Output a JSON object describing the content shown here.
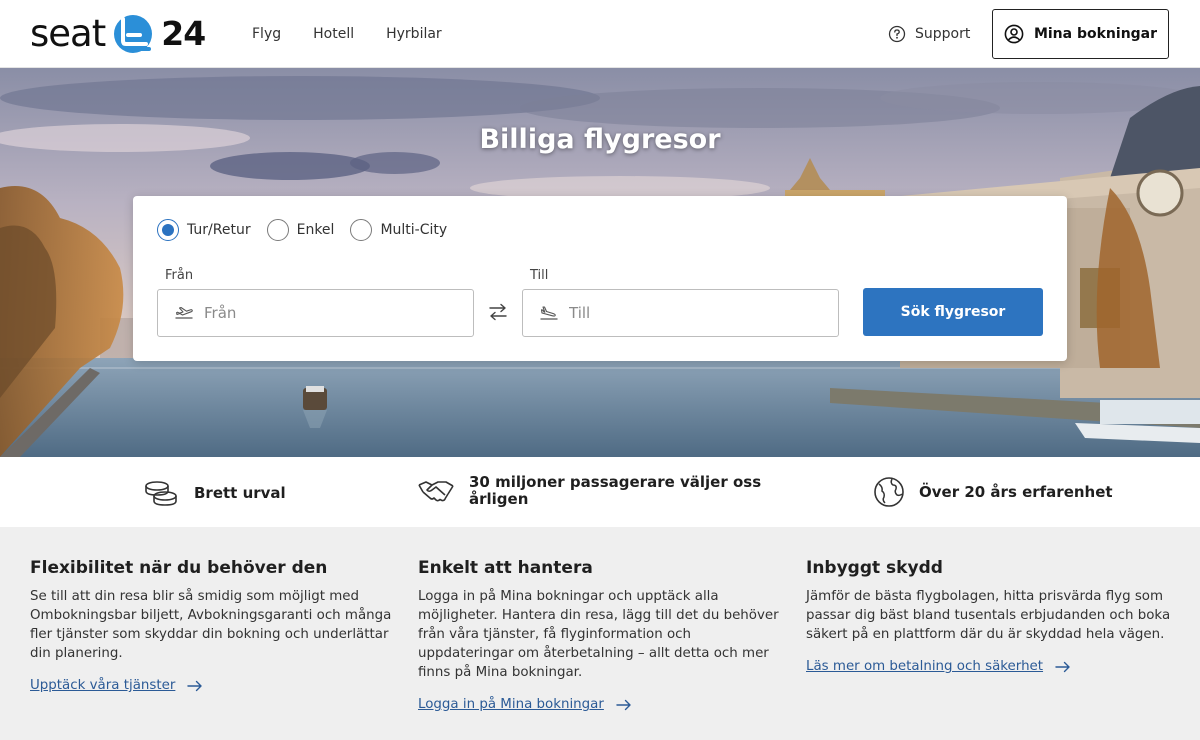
{
  "header": {
    "logo": {
      "word": "seat",
      "number": "24"
    },
    "nav": [
      "Flyg",
      "Hotell",
      "Hyrbilar"
    ],
    "support_label": "Support",
    "my_bookings_label": "Mina bokningar"
  },
  "hero": {
    "title": "Billiga flygresor"
  },
  "search": {
    "trip_types": [
      {
        "label": "Tur/Retur",
        "checked": true
      },
      {
        "label": "Enkel",
        "checked": false
      },
      {
        "label": "Multi-City",
        "checked": false
      }
    ],
    "from_label": "Från",
    "from_placeholder": "Från",
    "to_label": "Till",
    "to_placeholder": "Till",
    "submit_label": "Sök flygresor",
    "accent_color": "#2d74c0"
  },
  "usps": [
    {
      "icon": "coins-icon",
      "text": "Brett urval"
    },
    {
      "icon": "handshake-icon",
      "text_line1": "30 miljoner passagerare väljer oss",
      "text_line2": "årligen"
    },
    {
      "icon": "globe-icon",
      "text": "Över 20 års erfarenhet"
    }
  ],
  "info": [
    {
      "title": "Flexibilitet när du behöver den",
      "body": "Se till att din resa blir så smidig som möjligt med Ombokningsbar biljett, Avbokningsgaranti och många fler tjänster som skyddar din bokning och underlättar din planering.",
      "link": "Upptäck våra tjänster"
    },
    {
      "title": "Enkelt att hantera",
      "body": "Logga in på Mina bokningar och upptäck alla möjligheter. Hantera din resa, lägg till det du behöver från våra tjänster, få flyginformation och uppdateringar om återbetalning – allt detta och mer finns på Mina bokningar.",
      "link": "Logga in på Mina bokningar"
    },
    {
      "title": "Inbyggt skydd",
      "body": "Jämför de bästa flygbolagen, hitta prisvärda flyg som passar dig bäst bland tusentals erbjudanden och boka säkert på en plattform där du är skyddad hela vägen.",
      "link": "Läs mer om betalning och säkerhet"
    }
  ]
}
